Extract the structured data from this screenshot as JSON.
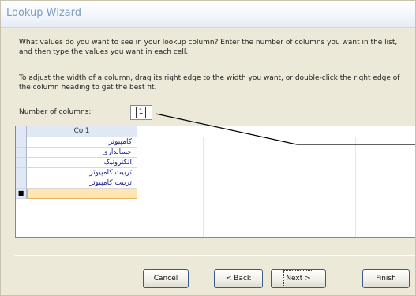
{
  "window": {
    "title": "Lookup Wizard"
  },
  "instructions": {
    "line1": "What values do you want to see in your lookup column? Enter the number of columns you want in the list, and then type the values you want in each cell.",
    "line2": "To adjust the width of a column, drag its right edge to the width you want, or double-click the right edge of the column heading to get the best fit."
  },
  "number_of_columns": {
    "label": "Number of columns:",
    "value": "1"
  },
  "grid": {
    "column_header": "Col1",
    "rows": [
      "کامپیوتر",
      "حسابداری",
      "الکترونیک",
      "تربیت کامپیوتر",
      "تربیت کامپیوتر",
      ""
    ],
    "new_row_marker": "■"
  },
  "buttons": {
    "cancel": "Cancel",
    "back": "< Back",
    "next": "Next >",
    "finish": "Finish"
  },
  "colors": {
    "background": "#ece9d8",
    "title_text": "#7f9dc0",
    "grid_header": "#dfe8f4",
    "active_row": "#ffe6b0"
  }
}
